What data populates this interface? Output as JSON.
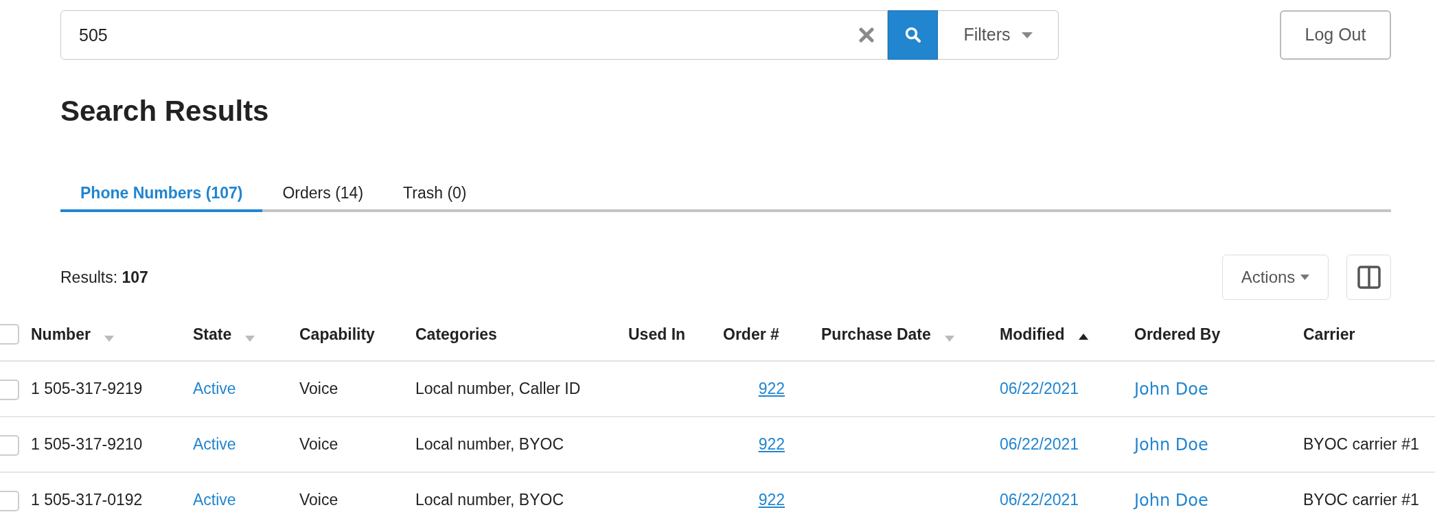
{
  "search": {
    "value": "505"
  },
  "filters_button": "Filters",
  "logout_button": "Log Out",
  "title": "Search Results",
  "tabs": [
    {
      "label": "Phone Numbers (107)",
      "selected": true
    },
    {
      "label": "Orders (14)",
      "selected": false
    },
    {
      "label": "Trash (0)",
      "selected": false
    }
  ],
  "results": "Results: **107**",
  "actions_button": "Actions",
  "table": {
    "select_all_checked": false,
    "columns": [
      {
        "label": "Number",
        "sortable": true,
        "sorted_ascending": false
      },
      {
        "label": "State",
        "sortable": true,
        "sorted_ascending": false
      },
      {
        "label": "Capability",
        "sortable": false
      },
      {
        "label": "Categories",
        "sortable": false
      },
      {
        "label": "Used In",
        "sortable": false
      },
      {
        "label": "Order #",
        "sortable": false
      },
      {
        "label": "Purchase Date",
        "sortable": true,
        "sorted_ascending": false
      },
      {
        "label": "Modified",
        "sortable": true,
        "sorted_ascending": true
      },
      {
        "label": "Ordered By",
        "sortable": false
      },
      {
        "label": "Carrier",
        "sortable": false
      }
    ],
    "rows": [
      {
        "checked": false,
        "number": "1 505-317-9219",
        "state": "Active",
        "capability": "Voice",
        "categories": "Local number, Caller ID",
        "order": "922",
        "modified": "06/22/2021",
        "ordered_by": "John Doe"
      },
      {
        "checked": false,
        "number": "1 505-317-9210",
        "state": "Active",
        "capability": "Voice",
        "categories": "Local number, BYOC",
        "order": "922",
        "modified": "06/22/2021",
        "ordered_by": "John Doe",
        "carrier": "BYOC carrier #1"
      },
      {
        "checked": false,
        "number": "1 505-317-0192",
        "state": "Active",
        "capability": "Voice",
        "categories": "Local number, BYOC",
        "order": "922",
        "modified": "06/22/2021",
        "ordered_by": "John Doe",
        "carrier": "BYOC carrier #1"
      }
    ]
  }
}
